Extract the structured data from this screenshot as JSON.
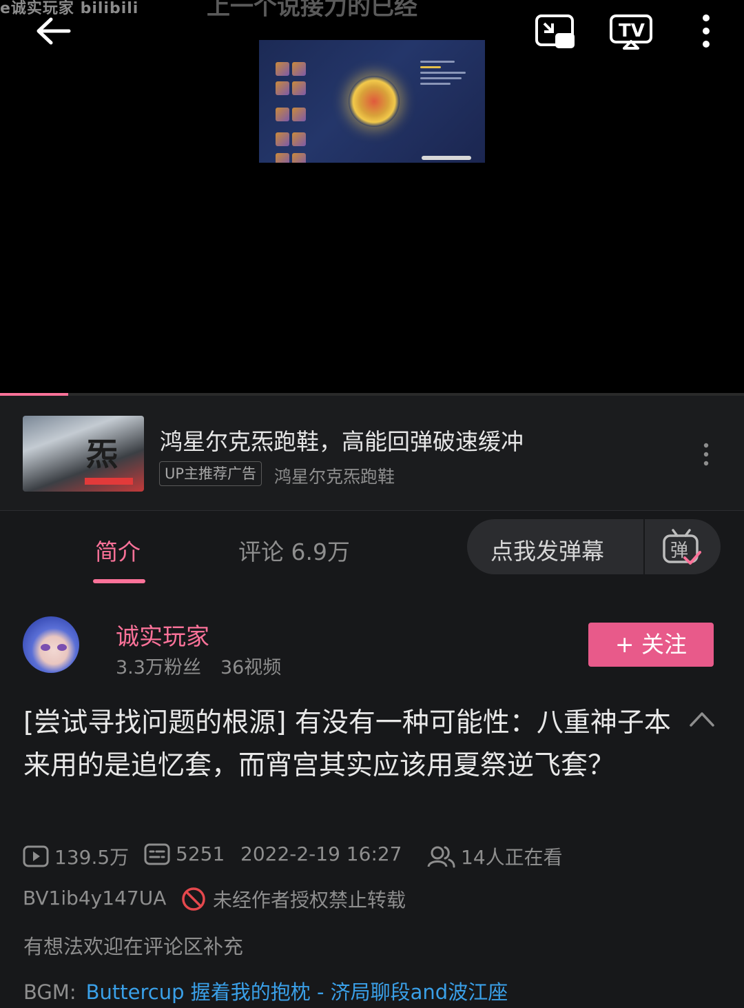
{
  "player": {
    "watermark": "e诚实玩家 bilibili",
    "ghost_title": "上一个说接力的已经",
    "progress_fraction": 0.092
  },
  "ad": {
    "title": "鸿星尔克炁跑鞋，高能回弹破速缓冲",
    "badge": "UP主推荐广告",
    "brand": "鸿星尔克炁跑鞋",
    "thumb_mark": "炁"
  },
  "tabs": {
    "intro": "简介",
    "comments": "评论 6.9万",
    "danmaku_placeholder": "点我发弹幕",
    "danmaku_icon_char": "弹"
  },
  "uploader": {
    "name": "诚实玩家",
    "fans": "3.3万粉丝",
    "videos": "36视频",
    "follow_label": "+ 关注"
  },
  "video": {
    "title": "[尝试寻找问题的根源] 有没有一种可能性：八重神子本来用的是追忆套，而宵宫其实应该用夏祭逆飞套？",
    "views": "139.5万",
    "danmaku_count": "5251",
    "date": "2022-2-19 16:27",
    "watching": "14人正在看",
    "bvid": "BV1ib4y147UA",
    "reprint_notice": "未经作者授权禁止转载",
    "description": "有想法欢迎在评论区补充",
    "bgm_label": "BGM:",
    "bgm_link": "Buttercup 握着我的抱枕 - 济局聊段and波江座"
  },
  "colors": {
    "accent": "#fb7299",
    "follow_bg": "#e85a8a",
    "link": "#3aa0e8",
    "background": "#17181a"
  }
}
